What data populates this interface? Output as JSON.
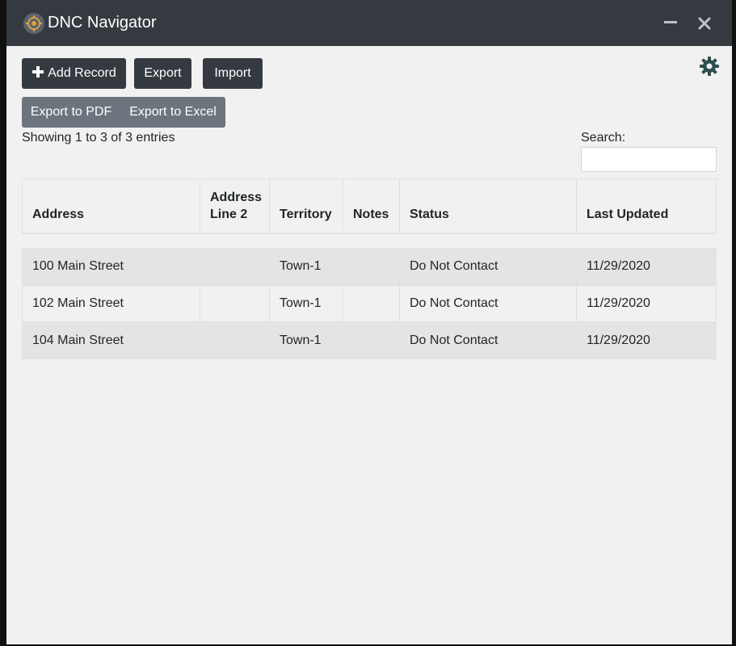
{
  "window": {
    "title": "DNC Navigator"
  },
  "toolbar": {
    "add_label": "Add Record",
    "export_label": "Export",
    "import_label": "Import"
  },
  "export_group": {
    "pdf_label": "Export to PDF",
    "excel_label": "Export to Excel"
  },
  "table_info": "Showing 1 to 3 of 3 entries",
  "search": {
    "label": "Search:",
    "value": "",
    "placeholder": ""
  },
  "table": {
    "headers": [
      "Address",
      "Address Line 2",
      "Territory",
      "Notes",
      "Status",
      "Last Updated"
    ],
    "rows": [
      [
        "100 Main Street",
        "",
        "Town-1",
        "",
        "Do Not Contact",
        "11/29/2020"
      ],
      [
        "102 Main Street",
        "",
        "Town-1",
        "",
        "Do Not Contact",
        "11/29/2020"
      ],
      [
        "104 Main Street",
        "",
        "Town-1",
        "",
        "Do Not Contact",
        "11/29/2020"
      ]
    ]
  },
  "icons": {
    "app": "app-logo-icon",
    "minimize": "minimize-icon",
    "close": "close-icon",
    "add": "plus-icon",
    "settings": "gear-icon"
  },
  "colors": {
    "titlebar": "#343a40",
    "button_dark": "#343a40",
    "button_secondary": "#6c757d",
    "gear": "#2f4f4f"
  }
}
